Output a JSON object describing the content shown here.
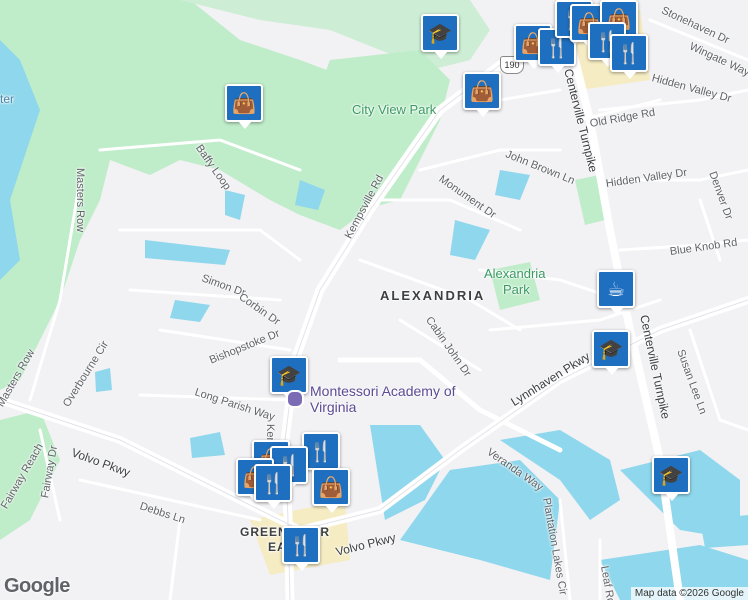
{
  "map": {
    "colors": {
      "land": "#f2f1f4",
      "water": "#8fd7ec",
      "park": "#bfecc9",
      "road": "#ffffff",
      "major_road": "#e3e3e8",
      "pin": "#1e6fbf",
      "commercial": "#f6ecc4"
    },
    "labels": {
      "city_view_park": "City View Park",
      "kempsville_rd": "Kempsville Rd",
      "kempsville_rd_short": "Ken",
      "baffy_loop": "Baffy Loop",
      "masters_row": "Masters Row",
      "simon_dr": "Simon Dr",
      "corbin_dr": "Corbin Dr",
      "bishopstoke_dr": "Bishopstoke Dr",
      "long_parish_way": "Long Parish Way",
      "overbourne_cir": "Overbourne Cir",
      "masters_row_w": "Masters Row",
      "fairway_reach": "Fairway Reach",
      "fairway_dr": "Fairway Dr",
      "volvo_pkwy_w": "Volvo Pkwy",
      "volvo_pkwy_s": "Volvo Pkwy",
      "debbs_ln": "Debbs Ln",
      "alexandria": "ALEXANDRIA",
      "alexandria_park_1": "Alexandria",
      "alexandria_park_2": "Park",
      "monument_dr": "Monument Dr",
      "john_brown_ln": "John Brown Ln",
      "cabin_john_dr": "Cabin John Dr",
      "lynnhaven_pkwy": "Lynnhaven Pkwy",
      "veranda_way": "Veranda Way",
      "centerville_tpke_n": "Centerville Turnpike",
      "centerville_tpke_s": "Centerville Turnpike",
      "hidden_valley_dr": "Hidden Valley Dr",
      "hidden_valley_dr_2": "Hidden Valley Dr",
      "old_ridge_rd": "Old Ridge Rd",
      "stonehaven_dr": "Stonehaven Dr",
      "wingate_way": "Wingate Way",
      "denver_dr": "Denver Dr",
      "blue_knob_rd": "Blue Knob Rd",
      "susan_lee_ln": "Susan Lee Ln",
      "plantation_lakes_cir": "Plantation Lakes Cir",
      "leaf_rd": "Leaf Rd",
      "montessori": "Montessori Academy of Virginia",
      "greenbrier_1": "GREENBRIER",
      "greenbrier_2": "EAST",
      "route_190": "190",
      "water_label": "ter"
    },
    "pins": [
      {
        "name": "school-pin",
        "icon": "graduation-cap-icon",
        "glyph": "🎓"
      },
      {
        "name": "shopping-pin",
        "icon": "shopping-bag-icon",
        "glyph": "👜"
      },
      {
        "name": "restaurant-pin",
        "icon": "fork-knife-icon",
        "glyph": "🍴"
      },
      {
        "name": "cafe-pin",
        "icon": "coffee-cup-icon",
        "glyph": "☕"
      }
    ],
    "google_logo": "Google",
    "attribution": "Map data ©2026 Google"
  }
}
